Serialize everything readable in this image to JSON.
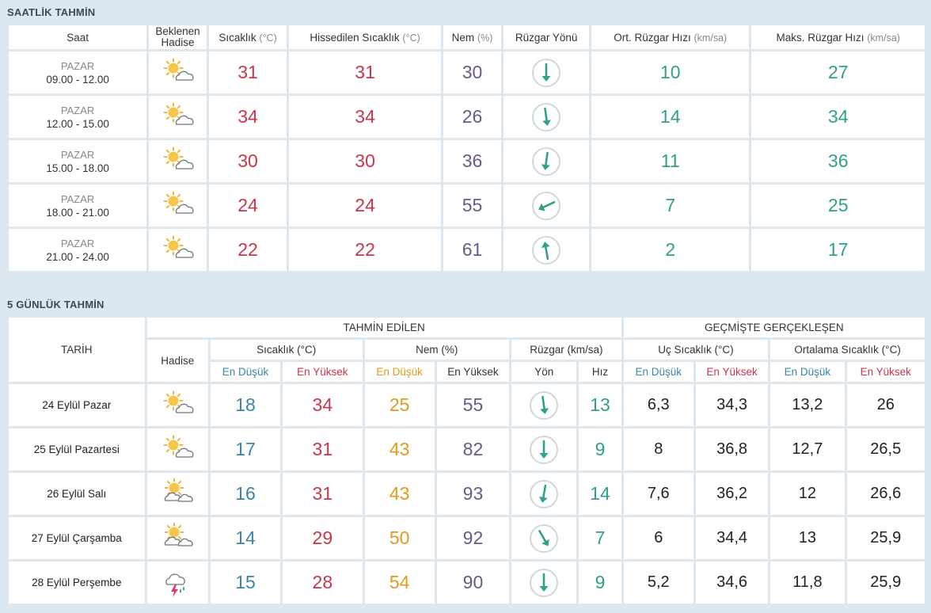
{
  "hourly": {
    "title": "SAATLİK TAHMİN",
    "headers": {
      "time": "Saat",
      "event": "Beklenen Hadise",
      "temp": "Sıcaklık",
      "temp_unit": "(°C)",
      "feels": "Hissedilen Sıcaklık",
      "feels_unit": "(°C)",
      "humidity": "Nem",
      "humidity_unit": "(%)",
      "wind_dir": "Rüzgar Yönü",
      "wind_avg": "Ort. Rüzgar Hızı",
      "wind_avg_unit": "(km/sa)",
      "wind_max": "Maks. Rüzgar Hızı",
      "wind_max_unit": "(km/sa)"
    },
    "rows": [
      {
        "day": "PAZAR",
        "time": "09.00 - 12.00",
        "icon": "partly-cloudy-icon",
        "temp": "31",
        "feels": "31",
        "humidity": "30",
        "wind_angle": 0,
        "wind_avg": "10",
        "wind_max": "27"
      },
      {
        "day": "PAZAR",
        "time": "12.00 - 15.00",
        "icon": "partly-cloudy-icon",
        "temp": "34",
        "feels": "34",
        "humidity": "26",
        "wind_angle": -8,
        "wind_avg": "14",
        "wind_max": "34"
      },
      {
        "day": "PAZAR",
        "time": "15.00 - 18.00",
        "icon": "partly-cloudy-icon",
        "temp": "30",
        "feels": "30",
        "humidity": "36",
        "wind_angle": 8,
        "wind_avg": "11",
        "wind_max": "36"
      },
      {
        "day": "PAZAR",
        "time": "18.00 - 21.00",
        "icon": "partly-cloudy-icon",
        "temp": "24",
        "feels": "24",
        "humidity": "55",
        "wind_angle": 65,
        "wind_avg": "7",
        "wind_max": "25"
      },
      {
        "day": "PAZAR",
        "time": "21.00 - 24.00",
        "icon": "partly-cloudy-icon",
        "temp": "22",
        "feels": "22",
        "humidity": "61",
        "wind_angle": 170,
        "wind_avg": "2",
        "wind_max": "17"
      }
    ]
  },
  "daily": {
    "title": "5 GÜNLÜK TAHMİN",
    "headers": {
      "date": "TARİH",
      "forecast": "TAHMİN EDİLEN",
      "observed": "GEÇMİŞTE GERÇEKLEŞEN",
      "event": "Hadise",
      "temp": "Sıcaklık (°C)",
      "humidity": "Nem (%)",
      "wind": "Rüzgar (km/sa)",
      "extreme_temp": "Uç Sıcaklık (°C)",
      "avg_temp": "Ortalama Sıcaklık (°C)",
      "low": "En Düşük",
      "high": "En Yüksek",
      "direction": "Yön",
      "speed": "Hız"
    },
    "rows": [
      {
        "date": "24 Eylül Pazar",
        "icon": "partly-cloudy-icon",
        "t_low": "18",
        "t_high": "34",
        "h_low": "25",
        "h_high": "55",
        "wind_angle": -8,
        "speed": "13",
        "ext_low": "6,3",
        "ext_high": "34,3",
        "avg_low": "13,2",
        "avg_high": "26"
      },
      {
        "date": "25 Eylül Pazartesi",
        "icon": "partly-cloudy-icon",
        "t_low": "17",
        "t_high": "31",
        "h_low": "43",
        "h_high": "82",
        "wind_angle": 0,
        "speed": "9",
        "ext_low": "8",
        "ext_high": "36,8",
        "avg_low": "12,7",
        "avg_high": "26,5"
      },
      {
        "date": "26 Eylül Salı",
        "icon": "mostly-cloudy-icon",
        "t_low": "16",
        "t_high": "31",
        "h_low": "43",
        "h_high": "93",
        "wind_angle": 10,
        "speed": "14",
        "ext_low": "7,6",
        "ext_high": "36,2",
        "avg_low": "12",
        "avg_high": "26,6"
      },
      {
        "date": "27 Eylül Çarşamba",
        "icon": "mostly-cloudy-icon",
        "t_low": "14",
        "t_high": "29",
        "h_low": "50",
        "h_high": "92",
        "wind_angle": -30,
        "speed": "7",
        "ext_low": "6",
        "ext_high": "34,4",
        "avg_low": "13",
        "avg_high": "25,9"
      },
      {
        "date": "28 Eylül Perşembe",
        "icon": "thunderstorm-rain-icon",
        "t_low": "15",
        "t_high": "28",
        "h_low": "54",
        "h_high": "90",
        "wind_angle": 0,
        "speed": "9",
        "ext_low": "5,2",
        "ext_high": "34,6",
        "avg_low": "11,8",
        "avg_high": "25,9"
      }
    ]
  },
  "colors": {
    "background": "#dde7ef",
    "temperature": "#c9364a",
    "humidity": "#6a5a88",
    "wind": "#2fa08a",
    "low": "#3a84a8",
    "humidity_low": "#e09a1c"
  }
}
